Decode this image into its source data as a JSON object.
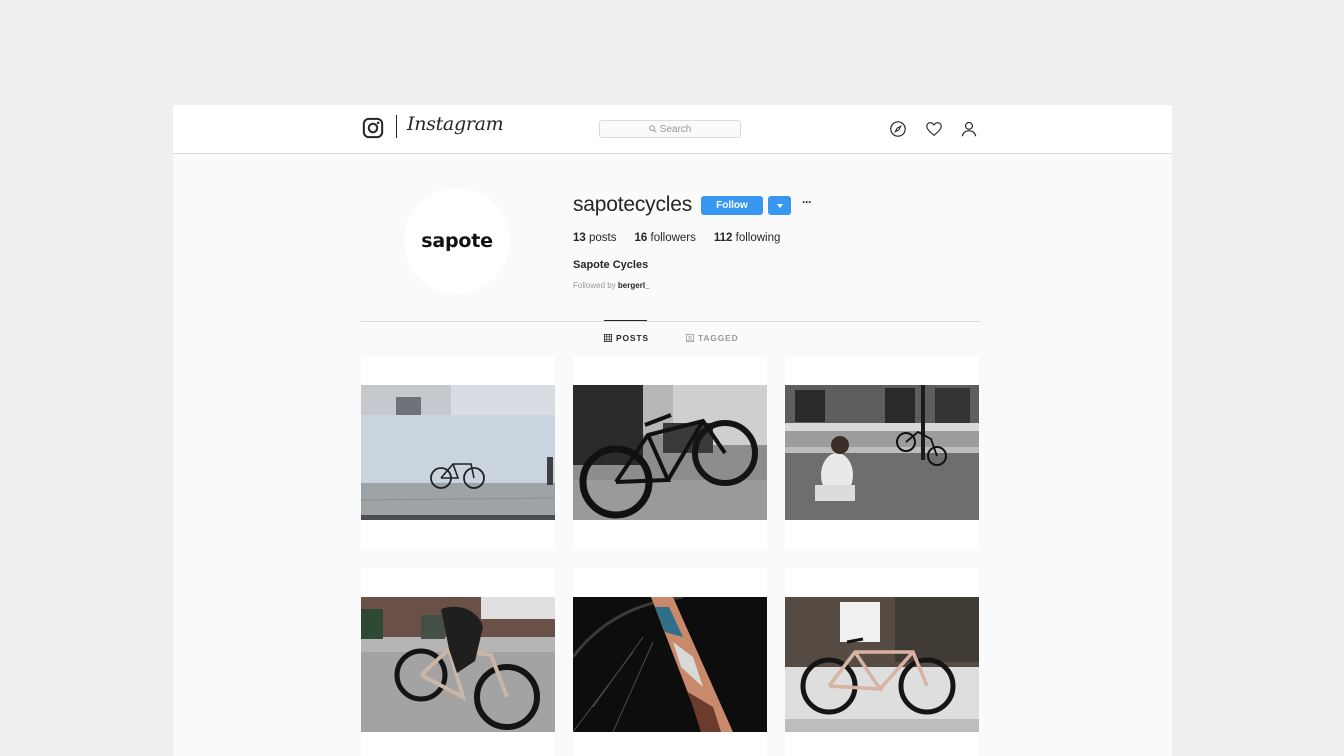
{
  "header": {
    "wordmark": "Instagram",
    "search_placeholder": "Search",
    "icons": [
      "instagram-glyph-icon",
      "compass-icon",
      "heart-icon",
      "person-icon"
    ]
  },
  "profile": {
    "avatar_text": "sapote",
    "username": "sapotecycles",
    "follow_label": "Follow",
    "more_label": "···",
    "stats": {
      "posts_count": "13",
      "posts_label": "posts",
      "followers_count": "16",
      "followers_label": "followers",
      "following_count": "112",
      "following_label": "following"
    },
    "full_name": "Sapote Cycles",
    "followed_by_prefix": "Followed by",
    "followed_by_user": "bergerl_"
  },
  "tabs": [
    {
      "label": "POSTS",
      "icon": "grid-icon",
      "active": true
    },
    {
      "label": "TAGGED",
      "icon": "tag-icon",
      "active": false
    }
  ],
  "colors": {
    "accent": "#3897f0",
    "background": "#efefef",
    "window": "#fafafa",
    "text": "#262626",
    "muted": "#999999"
  },
  "posts": [
    {
      "id": "post-1",
      "scene": "bike-against-white-wall"
    },
    {
      "id": "post-2",
      "scene": "black-bike-indoors"
    },
    {
      "id": "post-3",
      "scene": "person-photographing-bike"
    },
    {
      "id": "post-4",
      "scene": "person-with-patterned-bike"
    },
    {
      "id": "post-5",
      "scene": "wheel-closeup"
    },
    {
      "id": "post-6",
      "scene": "patterned-bike-by-hedge"
    }
  ]
}
